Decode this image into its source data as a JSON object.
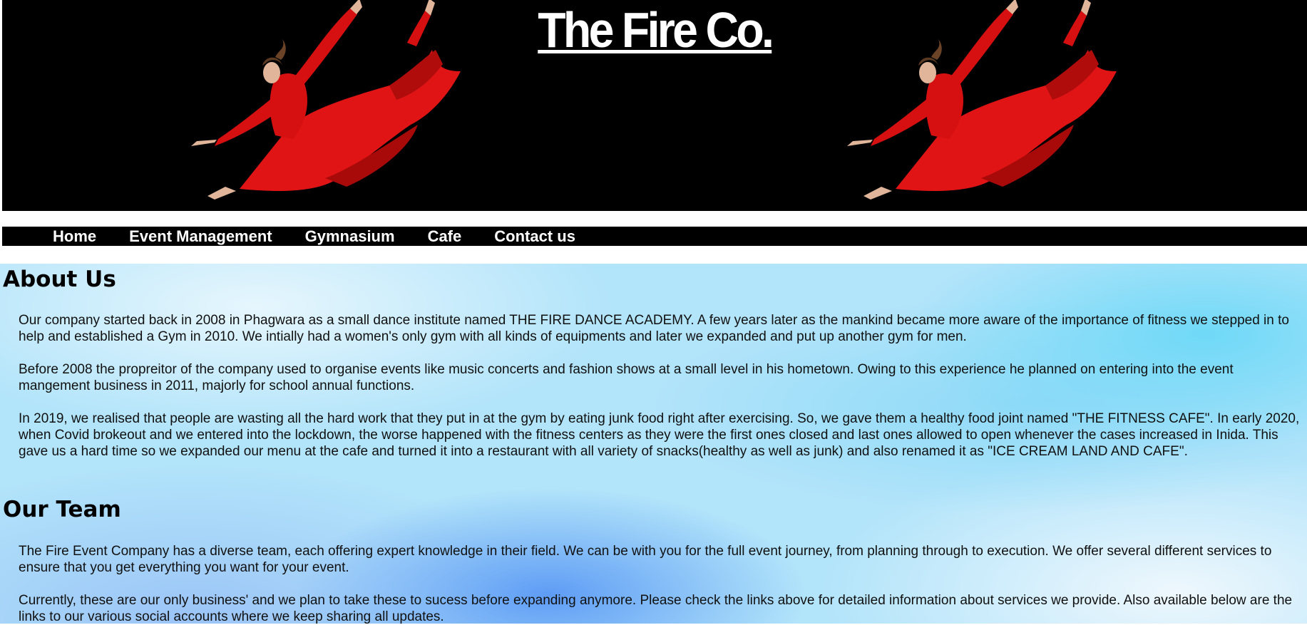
{
  "header": {
    "site_title": "The Fire Co."
  },
  "nav": {
    "items": [
      "Home",
      "Event Management",
      "Gymnasium",
      "Cafe",
      "Contact us"
    ]
  },
  "about": {
    "heading": "About Us",
    "paragraphs": [
      "Our company started back in 2008 in Phagwara as a small dance institute named THE FIRE DANCE ACADEMY. A few years later as the mankind became more aware of the importance of fitness we stepped in to help and established a Gym in 2010. We intially had a women's only gym with all kinds of equipments and later we expanded and put up another gym for men.",
      "Before 2008 the propreitor of the company used to organise events like music concerts and fashion shows at a small level in his hometown. Owing to this experience he planned on entering into the event mangement business in 2011, majorly for school annual functions.",
      "In 2019, we realised that people are wasting all the hard work that they put in at the gym by eating junk food right after exercising. So, we gave them a healthy food joint named \"THE FITNESS CAFE\". In early 2020, when Covid brokeout and we entered into the lockdown, the worse happened with the fitness centers as they were the first ones closed and last ones allowed to open whenever the cases increased in Inida. This gave us a hard time so we expanded our menu at the cafe and turned it into a restaurant with all variety of snacks(healthy as well as junk) and also renamed it as \"ICE CREAM LAND AND CAFE\"."
    ]
  },
  "team": {
    "heading": "Our Team",
    "paragraphs": [
      "The Fire Event Company has a diverse team, each offering expert knowledge in their field. We can be with you for the full event journey, from planning through to execution. We offer several different services to ensure that you get everything you want for your event.",
      "Currently, these are our only business' and we plan to take these to sucess before expanding anymore. Please check the links above for detailed information about services we provide. Also available below are the links to our various social accounts where we keep sharing all updates."
    ]
  },
  "colors": {
    "banner_bg": "#000000",
    "dancer_dress": "#e01414",
    "nav_bg": "#000000",
    "nav_text": "#ffffff"
  }
}
